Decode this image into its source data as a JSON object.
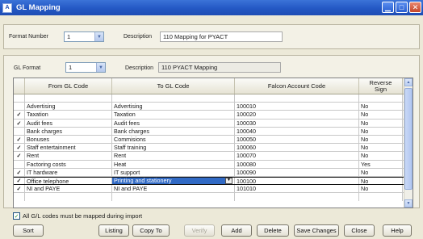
{
  "window": {
    "title": "GL Mapping",
    "app_icon": "A"
  },
  "format": {
    "number_label": "Format Number",
    "number_value": "1",
    "description_label": "Description",
    "description_value": "110 Mapping for PYACT"
  },
  "gl_format": {
    "label": "GL Format",
    "value": "1",
    "description_label": "Description",
    "description_value": "110 PYACT Mapping"
  },
  "grid": {
    "headers": [
      "From GL Code",
      "To GL Code",
      "Falcon Account Code",
      "Reverse Sign"
    ],
    "rows": [
      {
        "check": "",
        "from": "",
        "to": "",
        "falcon": "",
        "reverse": ""
      },
      {
        "check": "",
        "from": "Advertising",
        "to": "Advertising",
        "falcon": "100010",
        "reverse": "No"
      },
      {
        "check": "✓",
        "from": "Taxation",
        "to": "Taxation",
        "falcon": "100020",
        "reverse": "No"
      },
      {
        "check": "✓",
        "from": "Audit fees",
        "to": "Audit fees",
        "falcon": "100030",
        "reverse": "No"
      },
      {
        "check": "",
        "from": "Bank charges",
        "to": "Bank charges",
        "falcon": "100040",
        "reverse": "No"
      },
      {
        "check": "✓",
        "from": "Bonuses",
        "to": "Commisions",
        "falcon": "100050",
        "reverse": "No"
      },
      {
        "check": "✓",
        "from": "Staff entertainment",
        "to": "Staff training",
        "falcon": "100060",
        "reverse": "No"
      },
      {
        "check": "✓",
        "from": "Rent",
        "to": "Rent",
        "falcon": "100070",
        "reverse": "No"
      },
      {
        "check": "",
        "from": "Factoring costs",
        "to": "Heat",
        "falcon": "100080",
        "reverse": "Yes"
      },
      {
        "check": "✓",
        "from": "IT hardware",
        "to": "IT support",
        "falcon": "100090",
        "reverse": "No"
      },
      {
        "check": "✓",
        "from": "Office telephone",
        "to": "Printing and stationery",
        "falcon": "100100",
        "reverse": "No"
      },
      {
        "check": "✓",
        "from": "NI and PAYE",
        "to": "NI and PAYE",
        "falcon": "101010",
        "reverse": "No"
      }
    ]
  },
  "footer": {
    "checkbox_label": "All G/L codes must be mapped during import",
    "buttons": {
      "sort": "Sort",
      "listing": "Listing",
      "copy_to": "Copy To",
      "verify": "Verify",
      "add": "Add",
      "delete": "Delete",
      "save": "Save Changes",
      "close": "Close",
      "help": "Help"
    }
  },
  "colors": {
    "titlebar": "#2458c4",
    "selection": "#316ac5",
    "dialog_bg": "#ece9d8"
  }
}
